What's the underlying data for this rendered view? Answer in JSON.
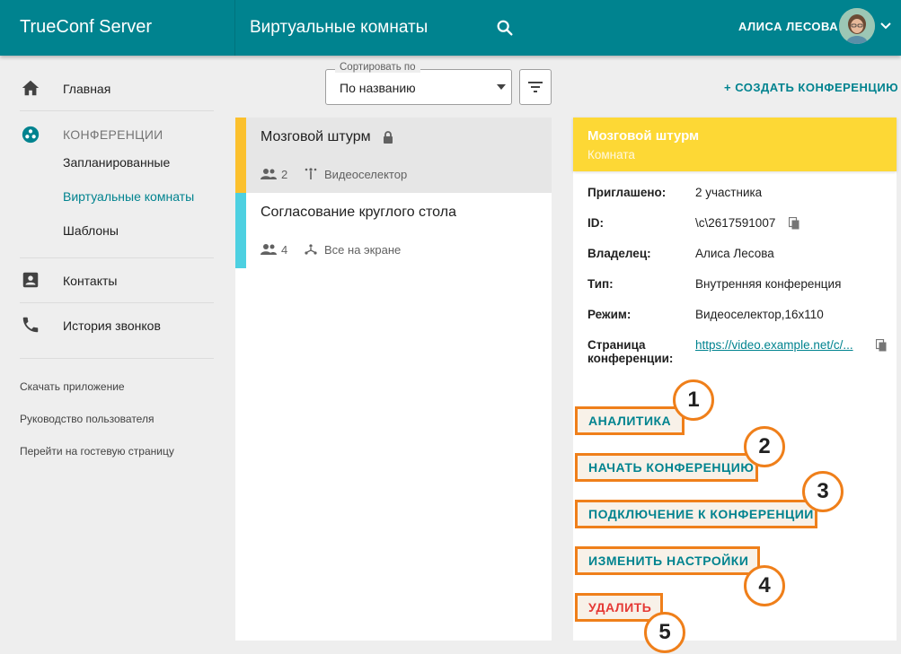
{
  "app": {
    "brand": "TrueConf Server",
    "page_title": "Виртуальные комнаты"
  },
  "user": {
    "name": "АЛИСА ЛЕСОВА"
  },
  "sidebar": {
    "home": "Главная",
    "conferences_section": "КОНФЕРЕНЦИИ",
    "scheduled": "Запланированные",
    "virtual_rooms": "Виртуальные комнаты",
    "templates": "Шаблоны",
    "contacts": "Контакты",
    "call_history": "История звонков",
    "links": [
      "Скачать приложение",
      "Руководство пользователя",
      "Перейти на гостевую страницу"
    ]
  },
  "sort": {
    "legend": "Сортировать по",
    "value": "По названию"
  },
  "create_label": "+ СОЗДАТЬ КОНФЕРЕНЦИЮ",
  "conferences": [
    {
      "title": "Мозговой штурм",
      "participants": "2",
      "mode": "Видеоселектор",
      "color": "#fbc02d"
    },
    {
      "title": "Согласование круглого стола",
      "participants": "4",
      "mode": "Все на экране",
      "color": "#4dd0e1"
    }
  ],
  "detail": {
    "title": "Мозговой штурм",
    "subtitle": "Комната",
    "rows": [
      {
        "label": "Приглашено:",
        "value": "2 участника"
      },
      {
        "label": "ID:",
        "value": "\\c\\2617591007"
      },
      {
        "label": "Владелец:",
        "value": "Алиса Лесова"
      },
      {
        "label": "Тип:",
        "value": "Внутренняя конференция"
      },
      {
        "label": "Режим:",
        "value": "Видеоселектор,16x110"
      },
      {
        "label": "Страница конференции:",
        "value": "https://video.example.net/c/..."
      }
    ],
    "actions": [
      {
        "label": "АНАЛИТИКА",
        "badge": "1"
      },
      {
        "label": "НАЧАТЬ КОНФЕРЕНЦИЮ",
        "badge": "2"
      },
      {
        "label": "ПОДКЛЮЧЕНИЕ К КОНФЕРЕНЦИИ",
        "badge": "3"
      },
      {
        "label": "ИЗМЕНИТЬ НАСТРОЙКИ",
        "badge": "4"
      },
      {
        "label": "УДАЛИТЬ",
        "badge": "5"
      }
    ]
  },
  "colors": {
    "primary": "#00838f",
    "accent_orange": "#ef7f1a",
    "header_yellow": "#fdd835",
    "danger": "#e53935"
  }
}
